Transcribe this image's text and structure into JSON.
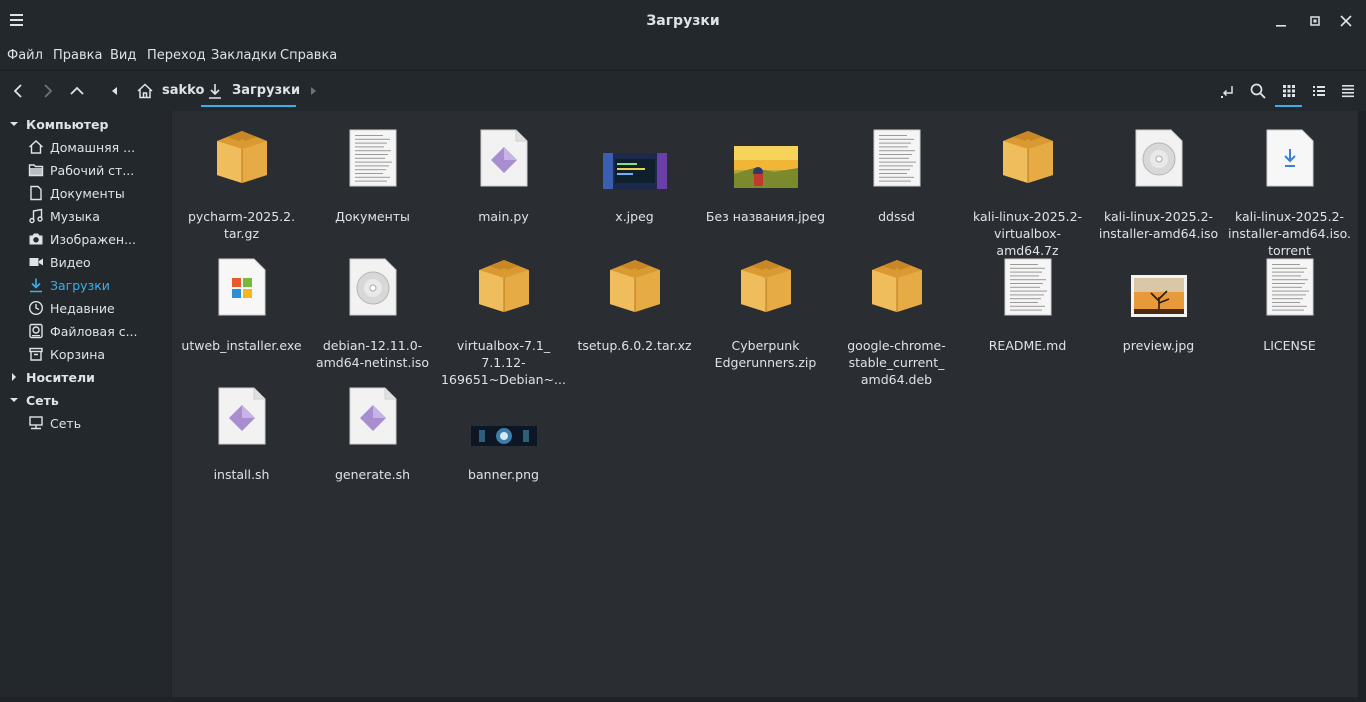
{
  "window": {
    "title": "Загрузки"
  },
  "menu": [
    "Файл",
    "Правка",
    "Вид",
    "Переход",
    "Закладки",
    "Справка"
  ],
  "breadcrumb": {
    "home": "sakko",
    "current": "Загрузки"
  },
  "sidebar": {
    "groups": [
      {
        "label": "Компьютер",
        "expanded": true
      },
      {
        "label": "Носители",
        "expanded": false
      },
      {
        "label": "Сеть",
        "expanded": true
      }
    ],
    "items": [
      {
        "label": "Домашняя ...",
        "icon": "home-icon"
      },
      {
        "label": "Рабочий ст...",
        "icon": "desktop-folder-icon"
      },
      {
        "label": "Документы",
        "icon": "document-icon"
      },
      {
        "label": "Музыка",
        "icon": "music-icon"
      },
      {
        "label": "Изображен...",
        "icon": "camera-icon"
      },
      {
        "label": "Видео",
        "icon": "video-icon"
      },
      {
        "label": "Загрузки",
        "icon": "download-icon",
        "active": true
      },
      {
        "label": "Недавние",
        "icon": "clock-icon"
      },
      {
        "label": "Файловая с...",
        "icon": "drive-icon"
      },
      {
        "label": "Корзина",
        "icon": "trash-icon"
      }
    ],
    "network_items": [
      {
        "label": "Сеть",
        "icon": "network-icon"
      }
    ]
  },
  "files": [
    {
      "name": "pycharm-2025.2.tar.gz",
      "lines": [
        "pycharm-2025.2.",
        "tar.gz"
      ],
      "type": "archive"
    },
    {
      "name": "Документы",
      "lines": [
        "Документы"
      ],
      "type": "text"
    },
    {
      "name": "main.py",
      "lines": [
        "main.py"
      ],
      "type": "script"
    },
    {
      "name": "x.jpeg",
      "lines": [
        "x.jpeg"
      ],
      "type": "image-x"
    },
    {
      "name": "Без названия.jpeg",
      "lines": [
        "Без названия.jpeg"
      ],
      "type": "image-sunset"
    },
    {
      "name": "ddssd",
      "lines": [
        "ddssd"
      ],
      "type": "text"
    },
    {
      "name": "kali-linux-2025.2-virtualbox-amd64.7z",
      "lines": [
        "kali-linux-2025.2-",
        "virtualbox-",
        "amd64.7z"
      ],
      "type": "archive"
    },
    {
      "name": "kali-linux-2025.2-installer-amd64.iso",
      "lines": [
        "kali-linux-2025.2-",
        "installer-amd64.iso"
      ],
      "type": "disc"
    },
    {
      "name": "kali-linux-2025.2-installer-amd64.iso.torrent",
      "lines": [
        "kali-linux-2025.2-",
        "installer-amd64.iso.",
        "torrent"
      ],
      "type": "torrent"
    },
    {
      "name": "utweb_installer.exe",
      "lines": [
        "utweb_installer.exe"
      ],
      "type": "exe"
    },
    {
      "name": "debian-12.11.0-amd64-netinst.iso",
      "lines": [
        "debian-12.11.0-",
        "amd64-netinst.iso"
      ],
      "type": "disc"
    },
    {
      "name": "virtualbox-7.1_7.1.12-169651~Debian~...",
      "lines": [
        "virtualbox-7.1_",
        "7.1.12-",
        "169651~Debian~..."
      ],
      "type": "archive"
    },
    {
      "name": "tsetup.6.0.2.tar.xz",
      "lines": [
        "tsetup.6.0.2.tar.xz"
      ],
      "type": "archive"
    },
    {
      "name": "Cyberpunk Edgerunners.zip",
      "lines": [
        "Cyberpunk",
        "Edgerunners.zip"
      ],
      "type": "archive"
    },
    {
      "name": "google-chrome-stable_current_amd64.deb",
      "lines": [
        "google-chrome-",
        "stable_current_",
        "amd64.deb"
      ],
      "type": "archive"
    },
    {
      "name": "README.md",
      "lines": [
        "README.md"
      ],
      "type": "text"
    },
    {
      "name": "preview.jpg",
      "lines": [
        "preview.jpg"
      ],
      "type": "image-tree"
    },
    {
      "name": "LICENSE",
      "lines": [
        "LICENSE"
      ],
      "type": "text"
    },
    {
      "name": "install.sh",
      "lines": [
        "install.sh"
      ],
      "type": "script"
    },
    {
      "name": "generate.sh",
      "lines": [
        "generate.sh"
      ],
      "type": "script"
    },
    {
      "name": "banner.png",
      "lines": [
        "banner.png"
      ],
      "type": "image-banner"
    }
  ],
  "colors": {
    "accent": "#3daee9",
    "background": "#2a2e32",
    "panel": "#23282c"
  }
}
